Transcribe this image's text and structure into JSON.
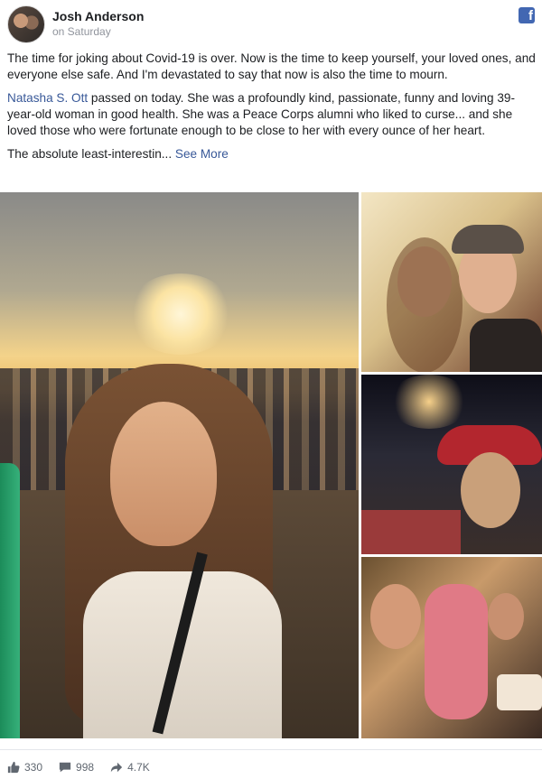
{
  "post": {
    "author": "Josh Anderson",
    "timestamp": "on Saturday",
    "platform_icon": "facebook-icon",
    "paragraph1": "The time for joking about Covid-19 is over. Now is the time to keep yourself, your loved ones, and everyone else safe. And I'm devastated to say that now is also the time to mourn.",
    "mention": "Natasha S. Ott",
    "paragraph2_rest": " passed on today. She was a profoundly kind, passionate, funny and loving 39-year-old woman in good health. She was a Peace Corps alumni who liked to curse... and she loved those who were fortunate enough to be close to her with every ounce of her heart.",
    "paragraph3": "The absolute least-interestin...",
    "see_more": "See More"
  },
  "colors": {
    "link": "#385898",
    "facebook_blue": "#4267b2",
    "muted": "#606770"
  },
  "stats": {
    "likes": "330",
    "comments": "998",
    "shares": "4.7K"
  },
  "icons": {
    "like": "thumbs-up-icon",
    "comment": "comment-icon",
    "share": "share-arrow-icon"
  }
}
